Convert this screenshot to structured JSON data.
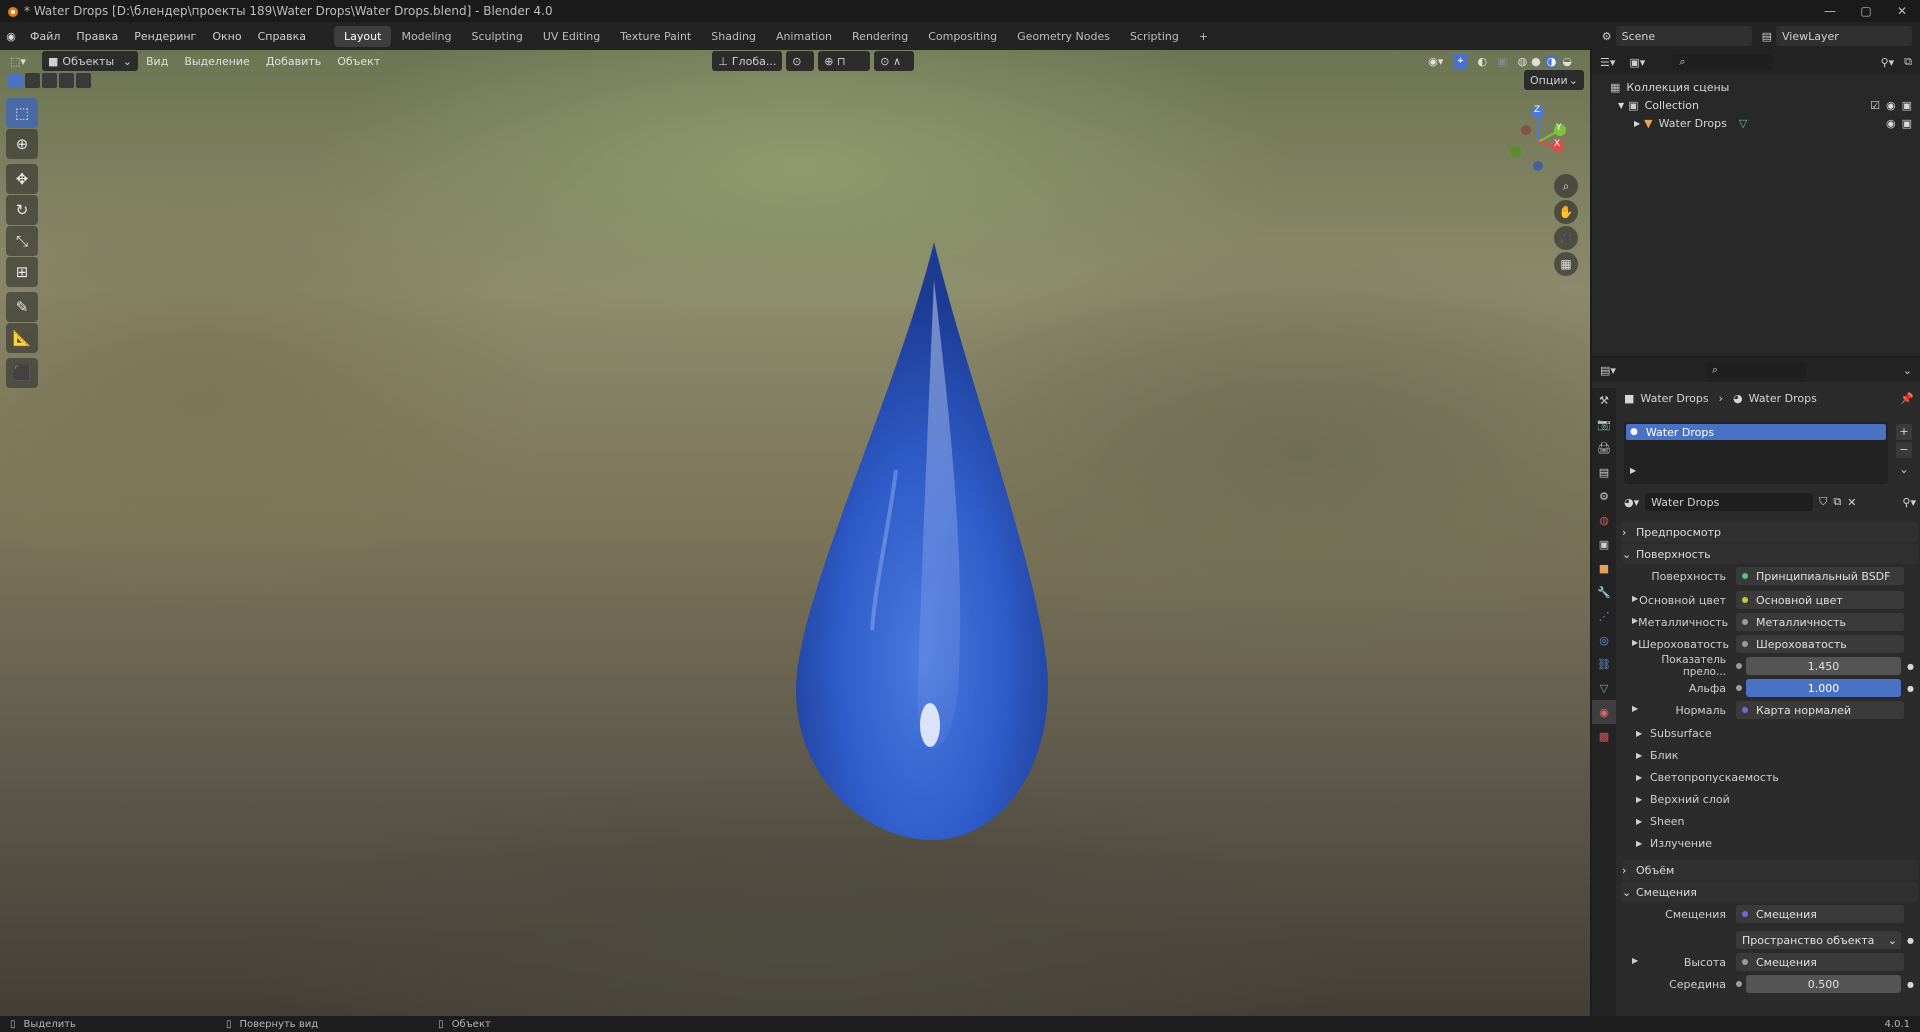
{
  "window": {
    "title": "* Water Drops [D:\\блендер\\проекты 189\\Water Drops\\Water Drops.blend] - Blender 4.0"
  },
  "menu": [
    "Файл",
    "Правка",
    "Рендеринг",
    "Окно",
    "Справка"
  ],
  "workspaces": [
    "Layout",
    "Modeling",
    "Sculpting",
    "UV Editing",
    "Texture Paint",
    "Shading",
    "Animation",
    "Rendering",
    "Compositing",
    "Geometry Nodes",
    "Scripting"
  ],
  "workspace_add": "+",
  "scene": {
    "name": "Scene",
    "view_layer": "ViewLayer"
  },
  "viewport": {
    "mode": "Объекты",
    "menu": [
      "Вид",
      "Выделение",
      "Добавить",
      "Объект"
    ],
    "transform": "Глоба...",
    "options": "Опции",
    "gizmo": {
      "x": "X",
      "y": "Y",
      "z": "Z"
    }
  },
  "outliner": {
    "root": "Коллекция сцены",
    "collection": "Collection",
    "object": "Water Drops"
  },
  "properties": {
    "breadcrumb_object": "Water Drops",
    "breadcrumb_material": "Water Drops",
    "slot": "Water Drops",
    "material_name": "Water Drops",
    "sections": {
      "preview": "Предпросмотр",
      "surface": "Поверхность",
      "volume": "Объём",
      "displacement": "Смещения"
    },
    "surface_rows": [
      {
        "label": "Поверхность",
        "value": "Принципиальный BSDF",
        "dot": "green"
      },
      {
        "label": "Основной цвет",
        "value": "Основной цвет",
        "dot": "yellow"
      },
      {
        "label": "Металличность",
        "value": "Металличность",
        "dot": "gray"
      },
      {
        "label": "Шероховатость",
        "value": "Шероховатость",
        "dot": "gray"
      },
      {
        "label": "Показатель прело...",
        "value": "1.450",
        "dot": "gray"
      },
      {
        "label": "Альфа",
        "value": "1.000",
        "dot": "gray"
      },
      {
        "label": "Нормаль",
        "value": "Карта нормалей",
        "dot": "purple"
      }
    ],
    "sub_panels": [
      "Subsurface",
      "Блик",
      "Светопропускаемость",
      "Верхний слой",
      "Sheen",
      "Излучение"
    ],
    "displacement_rows": [
      {
        "label": "Смещения",
        "value": "Смещения"
      },
      {
        "label": "",
        "value": "Пространство объекта"
      },
      {
        "label": "Высота",
        "value": "Смещения"
      },
      {
        "label": "Середина",
        "value": "0.500"
      }
    ]
  },
  "statusbar": {
    "left": "Выделить",
    "middle": "Повернуть вид",
    "right": "Объект",
    "version": "4.0.1"
  },
  "colors": {
    "accent": "#4a72c4",
    "drop": "#2f5cc9",
    "panel": "#2b2b2b"
  }
}
